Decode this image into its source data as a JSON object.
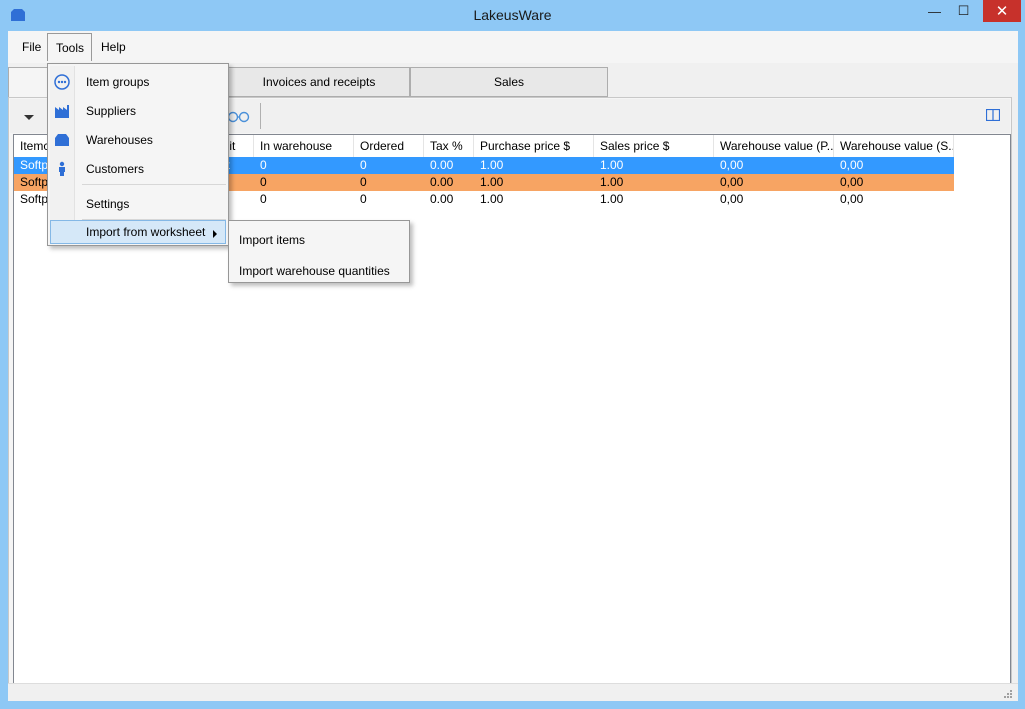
{
  "window": {
    "title": "LakeusWare",
    "minimize_glyph": "—",
    "maximize_glyph": "☐",
    "close_glyph": "✕"
  },
  "menubar": {
    "items": [
      "File",
      "Tools",
      "Help"
    ],
    "active": "Tools"
  },
  "tabs": [
    {
      "label": ""
    },
    {
      "label": "Invoices and receipts"
    },
    {
      "label": "Sales"
    }
  ],
  "table": {
    "columns": [
      "Itemco",
      "Unit",
      "In warehouse",
      "Ordered",
      "Tax %",
      "Purchase price $",
      "Sales price $",
      "Warehouse value (P...",
      "Warehouse value (S..."
    ],
    "rows": [
      {
        "state": "selected",
        "cells": [
          "Softpe",
          "et",
          "0",
          "0",
          "0.00",
          "1.00",
          "1.00",
          "0,00",
          "0,00"
        ]
      },
      {
        "state": "orange",
        "cells": [
          "Softpe",
          "",
          "0",
          "0",
          "0.00",
          "1.00",
          "1.00",
          "0,00",
          "0,00"
        ]
      },
      {
        "state": "normal",
        "cells": [
          "Softpe",
          "",
          "0",
          "0",
          "0.00",
          "1.00",
          "1.00",
          "0,00",
          "0,00"
        ]
      }
    ]
  },
  "tools_menu": {
    "items": [
      {
        "label": "Item groups",
        "icon": "item-groups-icon"
      },
      {
        "label": "Suppliers",
        "icon": "suppliers-icon"
      },
      {
        "label": "Warehouses",
        "icon": "warehouses-icon"
      },
      {
        "label": "Customers",
        "icon": "customers-icon"
      },
      {
        "label": "Settings",
        "icon": ""
      },
      {
        "label": "Import from worksheet",
        "icon": "",
        "has_submenu": true
      }
    ]
  },
  "import_submenu": {
    "items": [
      "Import items",
      "Import warehouse quantities"
    ]
  },
  "colors": {
    "titlebar": "#8ec8f5",
    "selection": "#3399ff",
    "orange_row": "#f7a463",
    "icon_blue": "#2f6fd6",
    "close_red": "#c7312b"
  }
}
